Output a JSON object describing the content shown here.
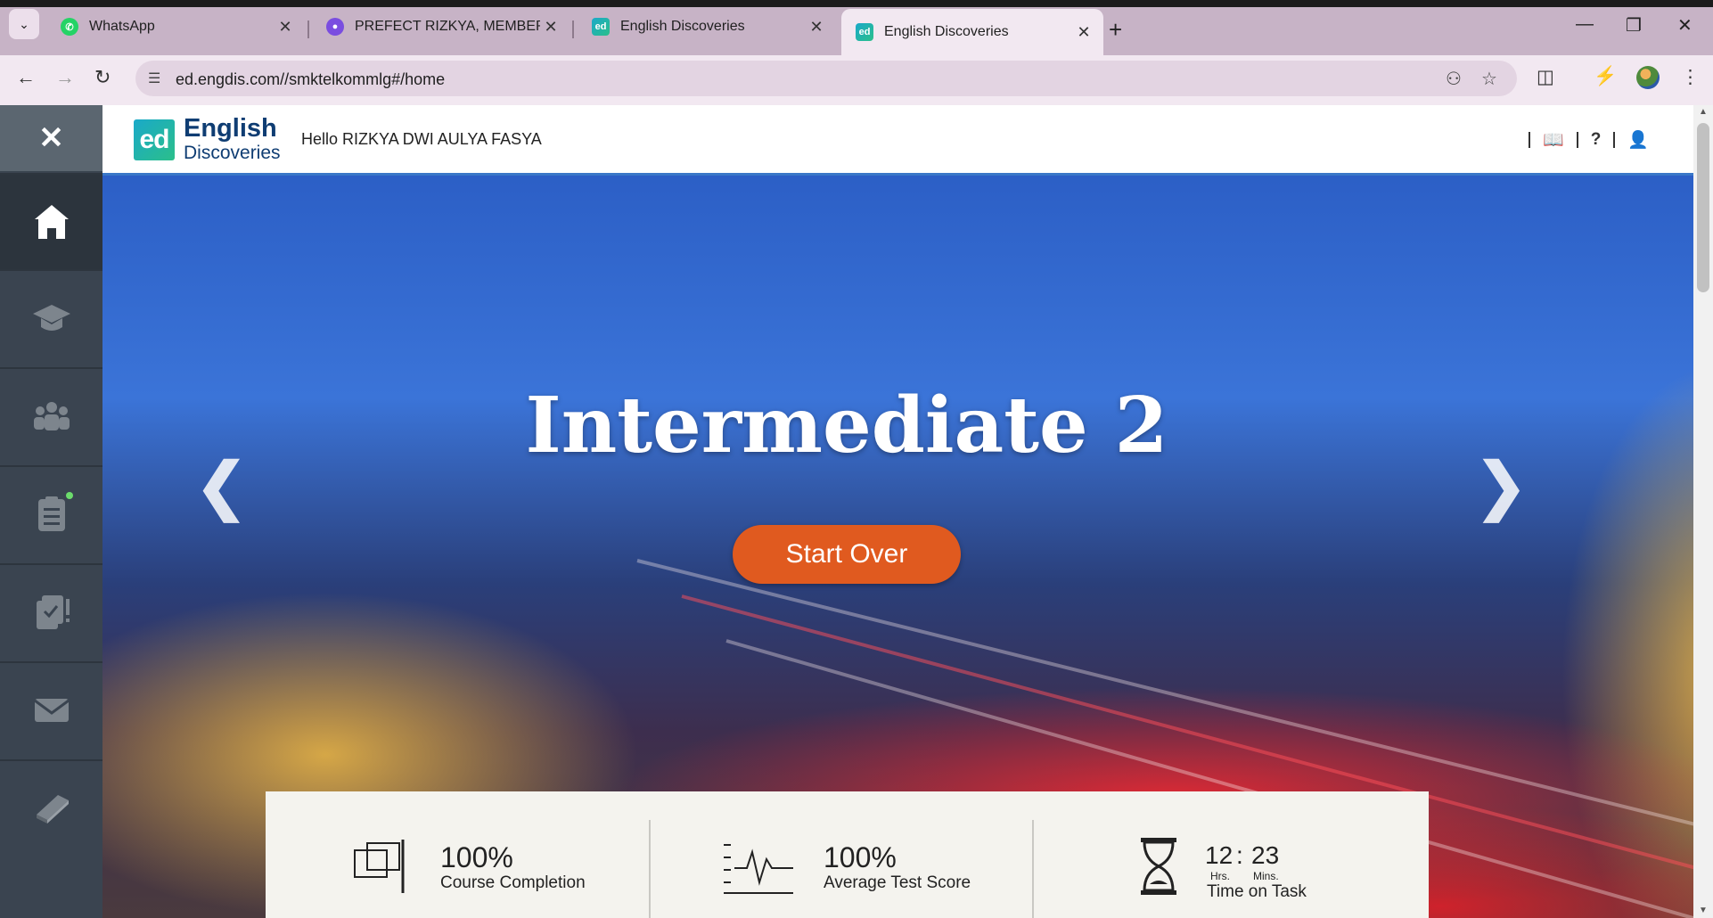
{
  "browser": {
    "tabs": [
      {
        "title": "WhatsApp",
        "favicon": "whatsapp-icon",
        "color": "#25d366",
        "active": false
      },
      {
        "title": "PREFECT RIZKYA, MEMBER CINI",
        "favicon": "app-icon",
        "color": "#7a4de0",
        "active": false
      },
      {
        "title": "English Discoveries",
        "favicon": "ed-icon",
        "color": "#1aa9c9",
        "active": false
      },
      {
        "title": "English Discoveries",
        "favicon": "ed-icon",
        "color": "#1aa9c9",
        "active": true
      }
    ],
    "url": "ed.engdis.com//smktelkommlg#/home"
  },
  "app": {
    "logo_line1": "English",
    "logo_line2": "Discoveries",
    "logo_mark": "ed",
    "greeting": "Hello RIZKYA DWI AULYA FASYA",
    "sidebar": [
      "close-icon",
      "home-icon",
      "graduation-cap-icon",
      "community-icon",
      "tasks-icon",
      "tests-icon",
      "messages-icon",
      "book-icon"
    ]
  },
  "hero": {
    "title": "Intermediate 2",
    "button": "Start Over"
  },
  "stats": {
    "completion_value": "100%",
    "completion_label": "Course Completion",
    "score_value": "100%",
    "score_label": "Average Test Score",
    "time_hours": "12",
    "time_sep": ":",
    "time_mins": "23",
    "time_hrs_label": "Hrs.",
    "time_mins_label": "Mins.",
    "time_label": "Time on Task"
  },
  "colors": {
    "accent": "#e05a1f",
    "sidebar": "#3a4450",
    "brand": "#0f3d73"
  }
}
